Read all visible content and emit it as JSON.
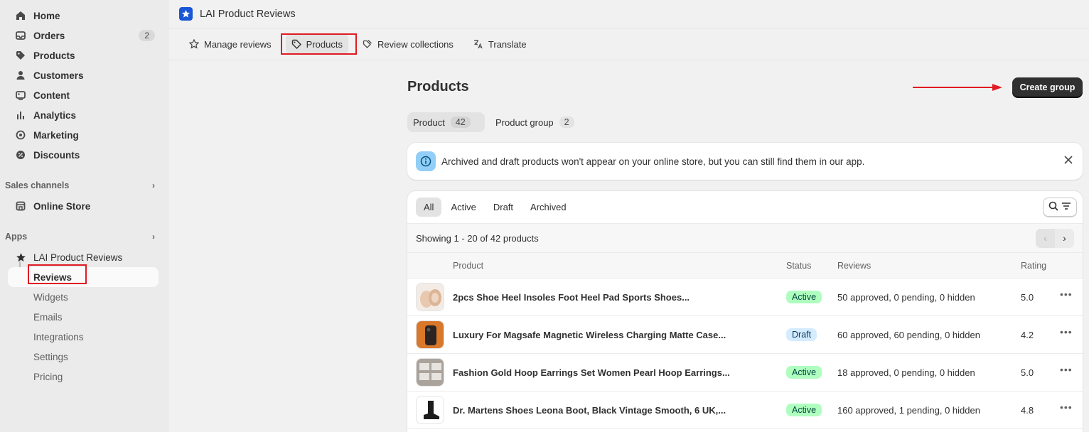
{
  "sidebar": {
    "items": [
      {
        "label": "Home",
        "icon": "home-icon"
      },
      {
        "label": "Orders",
        "icon": "inbox-icon",
        "badge": "2"
      },
      {
        "label": "Products",
        "icon": "tag-icon"
      },
      {
        "label": "Customers",
        "icon": "person-icon"
      },
      {
        "label": "Content",
        "icon": "content-icon"
      },
      {
        "label": "Analytics",
        "icon": "bar-chart-icon"
      },
      {
        "label": "Marketing",
        "icon": "target-icon"
      },
      {
        "label": "Discounts",
        "icon": "discount-icon"
      }
    ],
    "sales_channels_label": "Sales channels",
    "online_store": "Online Store",
    "apps_label": "Apps",
    "app_name": "LAI Product Reviews",
    "app_subitems": [
      "Reviews",
      "Widgets",
      "Emails",
      "Integrations",
      "Settings",
      "Pricing"
    ]
  },
  "header": {
    "title": "LAI Product Reviews"
  },
  "tabs": [
    {
      "label": "Manage reviews",
      "icon": "star-icon"
    },
    {
      "label": "Products",
      "icon": "tag-icon"
    },
    {
      "label": "Review collections",
      "icon": "collection-icon"
    },
    {
      "label": "Translate",
      "icon": "translate-icon"
    }
  ],
  "main": {
    "title": "Products",
    "create_button": "Create group",
    "segments": [
      {
        "label": "Product",
        "count": "42"
      },
      {
        "label": "Product group",
        "count": "2"
      }
    ],
    "banner": "Archived and draft products won't appear on your online store, but you can still find them in our app.",
    "filters": [
      "All",
      "Active",
      "Draft",
      "Archived"
    ],
    "showing": "Showing 1 - 20 of 42 products",
    "columns": {
      "product": "Product",
      "status": "Status",
      "reviews": "Reviews",
      "rating": "Rating"
    },
    "rows": [
      {
        "name": "2pcs Shoe Heel Insoles Foot Heel Pad Sports Shoes...",
        "status": "Active",
        "reviews": "50 approved, 0 pending, 0 hidden",
        "rating": "5.0"
      },
      {
        "name": "Luxury For Magsafe Magnetic Wireless Charging Matte Case...",
        "status": "Draft",
        "reviews": "60 approved, 60 pending, 0 hidden",
        "rating": "4.2"
      },
      {
        "name": "Fashion Gold Hoop Earrings Set Women Pearl Hoop Earrings...",
        "status": "Active",
        "reviews": "18 approved, 0 pending, 0 hidden",
        "rating": "5.0"
      },
      {
        "name": "Dr. Martens Shoes Leona Boot, Black Vintage Smooth, 6 UK,...",
        "status": "Active",
        "reviews": "160 approved, 1 pending, 0 hidden",
        "rating": "4.8"
      }
    ]
  },
  "colors": {
    "accent": "#303030",
    "annotation_red": "#e01b24",
    "active_badge": "#affebf",
    "draft_badge": "#d5ebff"
  }
}
